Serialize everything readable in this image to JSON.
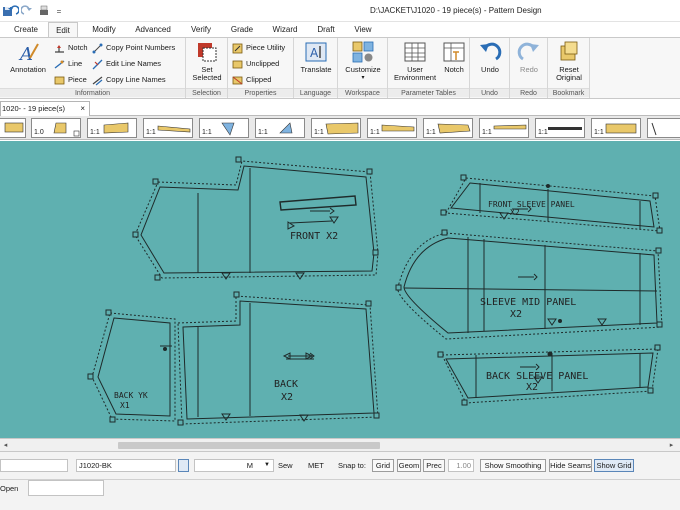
{
  "window": {
    "title": "D:\\JACKET\\J1020 - 19 piece(s) - Pattern Design",
    "quick_access_caret": "="
  },
  "tabs": [
    {
      "label": "Create"
    },
    {
      "label": "Edit"
    },
    {
      "label": "Modify"
    },
    {
      "label": "Advanced"
    },
    {
      "label": "Verify"
    },
    {
      "label": "Grade"
    },
    {
      "label": "Wizard"
    },
    {
      "label": "Draft"
    },
    {
      "label": "View"
    }
  ],
  "active_tab": "Edit",
  "ribbon": {
    "information": {
      "label": "Information",
      "annotation": "Annotation",
      "notch": "Notch",
      "line": "Line",
      "piece": "Piece",
      "copy_point_numbers": "Copy Point Numbers",
      "edit_line_names": "Edit Line Names",
      "copy_line_names": "Copy Line Names"
    },
    "selection": {
      "label": "Selection",
      "set_selected_1": "Set",
      "set_selected_2": "Selected"
    },
    "properties": {
      "label": "Properties",
      "piece_utility": "Piece Utility",
      "unclipped": "Unclipped",
      "clipped": "Clipped"
    },
    "language": {
      "label": "Language",
      "translate": "Translate"
    },
    "workspace": {
      "label": "Workspace",
      "customize": "Customize"
    },
    "parameter_tables": {
      "label": "Parameter Tables",
      "user_environment_1": "User",
      "user_environment_2": "Environment",
      "notch": "Notch"
    },
    "undo": {
      "label": "Undo",
      "undo": "Undo"
    },
    "redo": {
      "label": "Redo",
      "redo": "Redo"
    },
    "bookmark": {
      "label": "Bookmark",
      "reset_1": "Reset",
      "reset_2": "Original"
    }
  },
  "document_tab": {
    "label": "1020- - 19 piece(s)",
    "close": "×"
  },
  "piece_strip": {
    "scales": [
      "",
      "1.0",
      "1:1",
      "1:1",
      "1:1",
      "1:1",
      "1:1",
      "1:1",
      "1:1",
      "1:1",
      "1:1",
      "1:1"
    ]
  },
  "pieces": {
    "front": "FRONT X2",
    "back_1": "BACK",
    "back_2": "X2",
    "back_yk_1": "BACK YK",
    "back_yk_2": "X1",
    "front_sleeve_1": "FRONT SLEEVE PANEL",
    "front_sleeve_2": "X2",
    "sleeve_mid_1": "SLEEVE MID PANEL",
    "sleeve_mid_2": "X2",
    "back_sleeve_1": "BACK SLEEVE PANEL",
    "back_sleeve_2": "X2"
  },
  "status_bar": {
    "piece_name": "J1020-BK",
    "size": "M",
    "sew": "Sew",
    "units": "MET",
    "snap_to": "Snap to:",
    "grid": "Grid",
    "geom": "Geom",
    "prec": "Prec",
    "precision_value": "1.00",
    "show_smoothing": "Show Smoothing",
    "hide_seams": "Hide Seams",
    "show_grid": "Show Grid"
  },
  "command": {
    "label": "Open",
    "value": ""
  },
  "colors": {
    "canvas_bg": "#5fb0b0",
    "piece_line": "#1e2a2a",
    "undo_blue": "#2a6db5"
  }
}
